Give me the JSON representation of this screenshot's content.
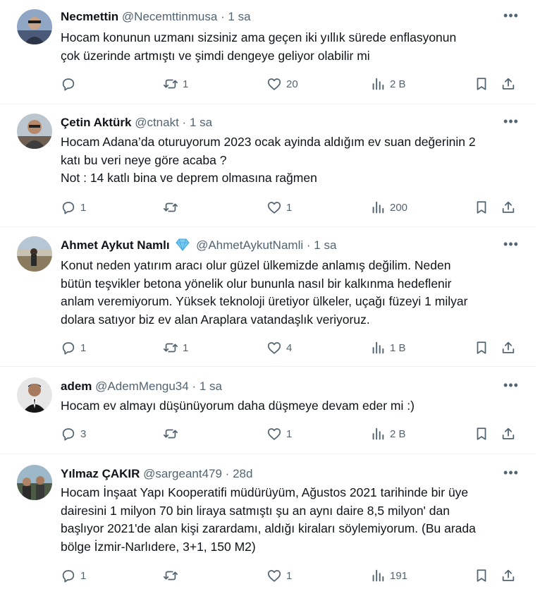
{
  "more_label": "•••",
  "tweets": [
    {
      "name": "Necmettin",
      "handle": "@Necemttinmusa",
      "sep": "·",
      "time": "1 sa",
      "verified": false,
      "text": "Hocam konunun uzmanı sizsiniz ama geçen iki yıllık sürede enflasyonun\nçok üzerinde artmıştı ve şimdi dengeye geliyor olabilir mi",
      "replies": "",
      "retweets": "1",
      "likes": "20",
      "views": "2 B"
    },
    {
      "name": "Çetin Aktürk",
      "handle": "@ctnakt",
      "sep": "·",
      "time": "1 sa",
      "verified": false,
      "text": "Hocam Adana’da oturuyorum 2023 ocak ayinda aldığım ev suan değerinin 2\nkatı bu veri neye göre acaba ?\nNot : 14 katlı bina ve deprem olmasına rağmen",
      "replies": "1",
      "retweets": "",
      "likes": "1",
      "views": "200"
    },
    {
      "name": "Ahmet Aykut Namlı",
      "handle": "@AhmetAykutNamli",
      "sep": "·",
      "time": "1 sa",
      "verified": true,
      "text": "Konut neden yatırım aracı olur güzel ülkemizde anlamış değilim. Neden\nbütün teşvikler betona yönelik olur bununla nasıl bir kalkınma hedeflenir\nanlam veremiyorum. Yüksek teknoloji üretiyor ülkeler, uçağı füzeyi 1 milyar\ndolara satıyor biz ev alan Araplara vatandaşlık veriyoruz.",
      "replies": "1",
      "retweets": "1",
      "likes": "4",
      "views": "1 B"
    },
    {
      "name": "adem",
      "handle": "@AdemMengu34",
      "sep": "·",
      "time": "1 sa",
      "verified": false,
      "text": "Hocam ev almayı düşünüyorum daha düşmeye devam eder mi :)",
      "replies": "3",
      "retweets": "",
      "likes": "1",
      "views": "2 B"
    },
    {
      "name": "Yılmaz ÇAKIR",
      "handle": "@sargeant479",
      "sep": "·",
      "time": "28d",
      "verified": false,
      "text": "Hocam İnşaat Yapı Kooperatifi müdürüyüm, Ağustos 2021 tarihinde bir üye\ndairesini 1 milyon 70 bin liraya satmıştı şu an aynı daire 8,5 milyon' dan\nbaşlıyor 2021'de alan kişi zarardamı, aldığı kiraları söylemiyorum. (Bu arada\nbölge İzmir-Narlıdere, 3+1, 150 M2)",
      "replies": "1",
      "retweets": "",
      "likes": "1",
      "views": "191"
    }
  ]
}
